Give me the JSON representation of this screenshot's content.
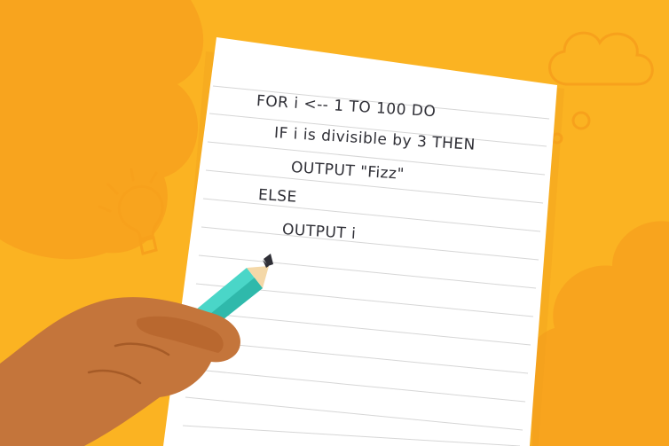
{
  "illustration": {
    "background_color": "#fbb322",
    "accent_color": "#f8a41e",
    "paper_color": "#ffffff",
    "pencil_color": "#4ad6c8",
    "skin_color": "#c4753b",
    "icons": [
      "cloud-icon",
      "lightbulb-icon",
      "pencil-icon",
      "hand-icon"
    ]
  },
  "pseudocode": {
    "lines": [
      "FOR i <-- 1 TO 100 DO",
      "IF i is divisible by 3 THEN",
      "OUTPUT \"Fizz\"",
      "ELSE",
      "OUTPUT i"
    ]
  }
}
